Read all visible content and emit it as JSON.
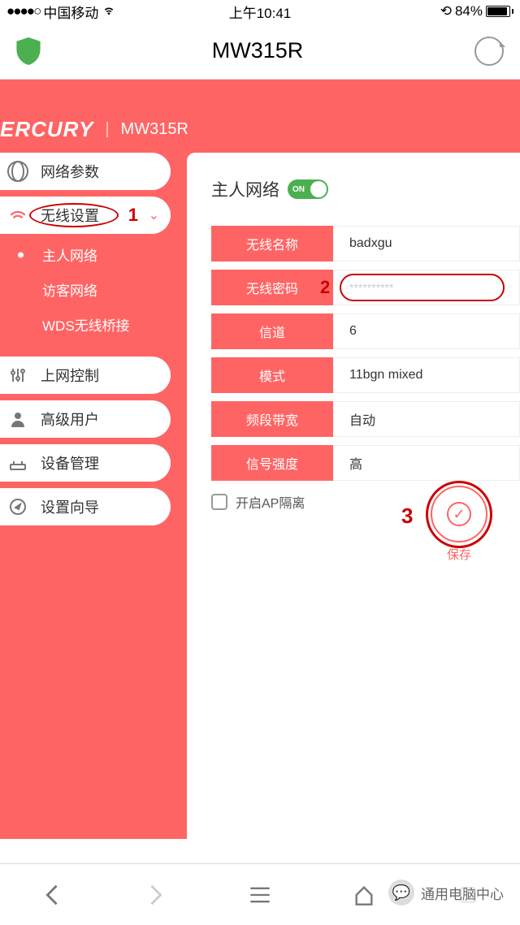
{
  "status": {
    "carrier": "中国移动",
    "time": "上午10:41",
    "battery": "84%",
    "signal": "●●●●○"
  },
  "url_bar": {
    "title": "MW315R"
  },
  "brand": {
    "name": "ERCURY",
    "model": "MW315R"
  },
  "nav": {
    "items": [
      {
        "label": "网络参数"
      },
      {
        "label": "无线设置"
      },
      {
        "label": "上网控制"
      },
      {
        "label": "高级用户"
      },
      {
        "label": "设备管理"
      },
      {
        "label": "设置向导"
      }
    ],
    "sub": [
      {
        "label": "主人网络"
      },
      {
        "label": "访客网络"
      },
      {
        "label": "WDS无线桥接"
      }
    ]
  },
  "main": {
    "title": "主人网络",
    "toggle": "ON",
    "rows": [
      {
        "label": "无线名称",
        "value": "badxgu"
      },
      {
        "label": "无线密码",
        "value": "**********"
      },
      {
        "label": "信道",
        "value": "6"
      },
      {
        "label": "模式",
        "value": "11bgn mixed"
      },
      {
        "label": "频段带宽",
        "value": "自动"
      },
      {
        "label": "信号强度",
        "value": "高"
      }
    ],
    "ap_isolation": "开启AP隔离",
    "save": "保存"
  },
  "annotations": {
    "step1": "1",
    "step2": "2",
    "step3": "3"
  },
  "wechat": {
    "text": "通用电脑中心"
  }
}
